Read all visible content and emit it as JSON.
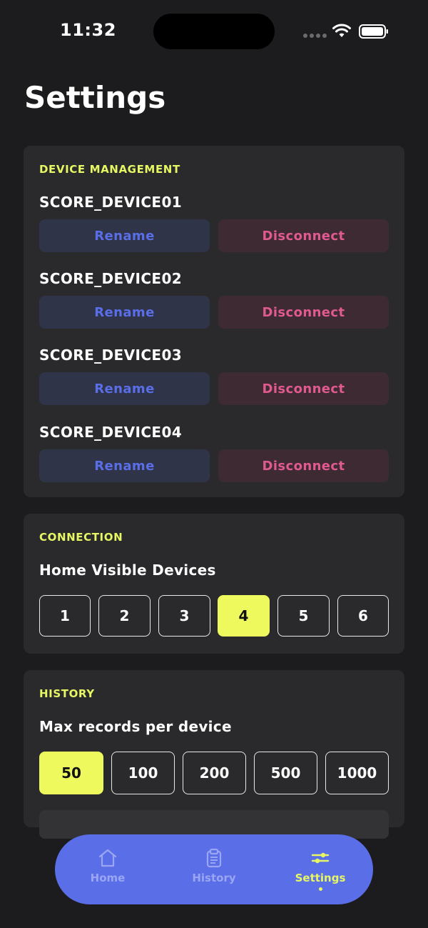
{
  "status_bar": {
    "time": "11:32"
  },
  "page": {
    "title": "Settings"
  },
  "device_management": {
    "section_label": "DEVICE MANAGEMENT",
    "devices": [
      {
        "name": "SCORE_DEVICE01",
        "rename_label": "Rename",
        "disconnect_label": "Disconnect"
      },
      {
        "name": "SCORE_DEVICE02",
        "rename_label": "Rename",
        "disconnect_label": "Disconnect"
      },
      {
        "name": "SCORE_DEVICE03",
        "rename_label": "Rename",
        "disconnect_label": "Disconnect"
      },
      {
        "name": "SCORE_DEVICE04",
        "rename_label": "Rename",
        "disconnect_label": "Disconnect"
      }
    ]
  },
  "connection": {
    "section_label": "CONNECTION",
    "row_label": "Home Visible Devices",
    "options": [
      "1",
      "2",
      "3",
      "4",
      "5",
      "6"
    ],
    "selected": "4"
  },
  "history": {
    "section_label": "HISTORY",
    "row_label": "Max records per device",
    "options": [
      "50",
      "100",
      "200",
      "500",
      "1000"
    ],
    "selected": "50"
  },
  "tab_bar": {
    "tabs": [
      {
        "label": "Home",
        "icon": "home-icon",
        "active": false
      },
      {
        "label": "History",
        "icon": "clipboard-icon",
        "active": false
      },
      {
        "label": "Settings",
        "icon": "sliders-icon",
        "active": true
      }
    ]
  },
  "colors": {
    "background": "#1c1c1e",
    "card": "#2a2a2c",
    "accent_yellow": "#eef95e",
    "section_label": "#e6f763",
    "rename_text": "#5a6ee8",
    "disconnect_text": "#e05a8f",
    "tab_bar": "#5a6ee8"
  }
}
